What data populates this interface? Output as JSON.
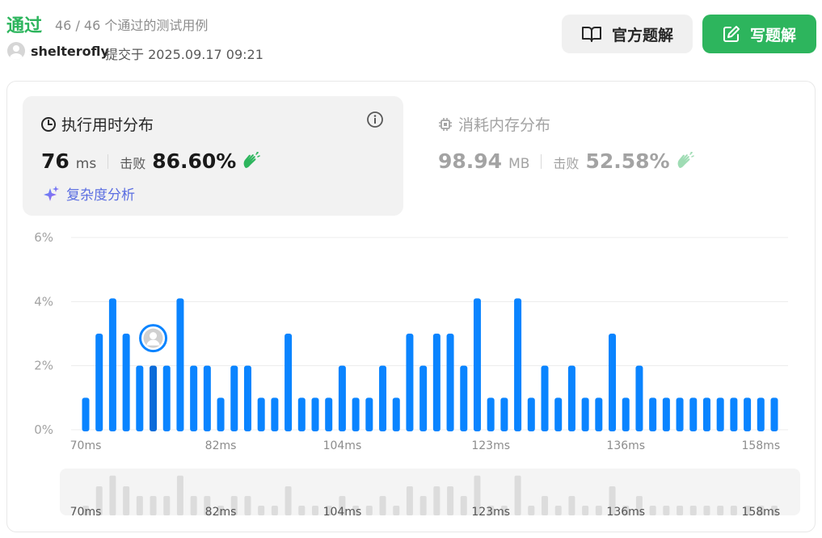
{
  "header": {
    "status": "通过",
    "testcases": "46 / 46 个通过的测试用例",
    "username": "shelterofly",
    "submitted": "提交于 2025.09.17 09:21",
    "official_button": "官方题解",
    "write_button": "写题解"
  },
  "runtime": {
    "title": "执行用时分布",
    "value": "76",
    "unit": "ms",
    "beats_label": "击败",
    "beats": "86.60%"
  },
  "memory": {
    "title": "消耗内存分布",
    "value": "98.94",
    "unit": "MB",
    "beats_label": "击败",
    "beats": "52.58%"
  },
  "complexity_label": "复杂度分析",
  "colors": {
    "accent_green": "#2db55d",
    "bar_blue": "#0a84ff",
    "bar_highlight": "#0b6bd9",
    "nav_bar_gray": "#dcdcdc",
    "complexity_purple": "#5b6ee1"
  },
  "chart_data": {
    "type": "bar",
    "xlabel": "",
    "ylabel": "",
    "y_tick_labels": [
      "0%",
      "2%",
      "4%",
      "6%"
    ],
    "ylim": [
      0,
      6
    ],
    "x_tick_labels": [
      "70ms",
      "82ms",
      "104ms",
      "123ms",
      "136ms",
      "158ms"
    ],
    "x_tick_bar_index": [
      0,
      10,
      19,
      30,
      40,
      50
    ],
    "values": [
      1,
      3,
      4.1,
      3,
      2,
      2,
      2,
      4.1,
      2,
      2,
      1,
      2,
      2,
      1,
      1,
      3,
      1,
      1,
      1,
      2,
      1,
      1,
      2,
      1,
      3,
      2,
      3,
      3,
      2,
      4.1,
      1,
      1,
      4.1,
      1,
      2,
      1,
      2,
      1,
      1,
      3,
      1,
      2,
      1,
      1,
      1,
      1,
      1,
      1,
      1,
      1,
      1,
      1
    ],
    "highlight_index": 5,
    "grid": true
  }
}
